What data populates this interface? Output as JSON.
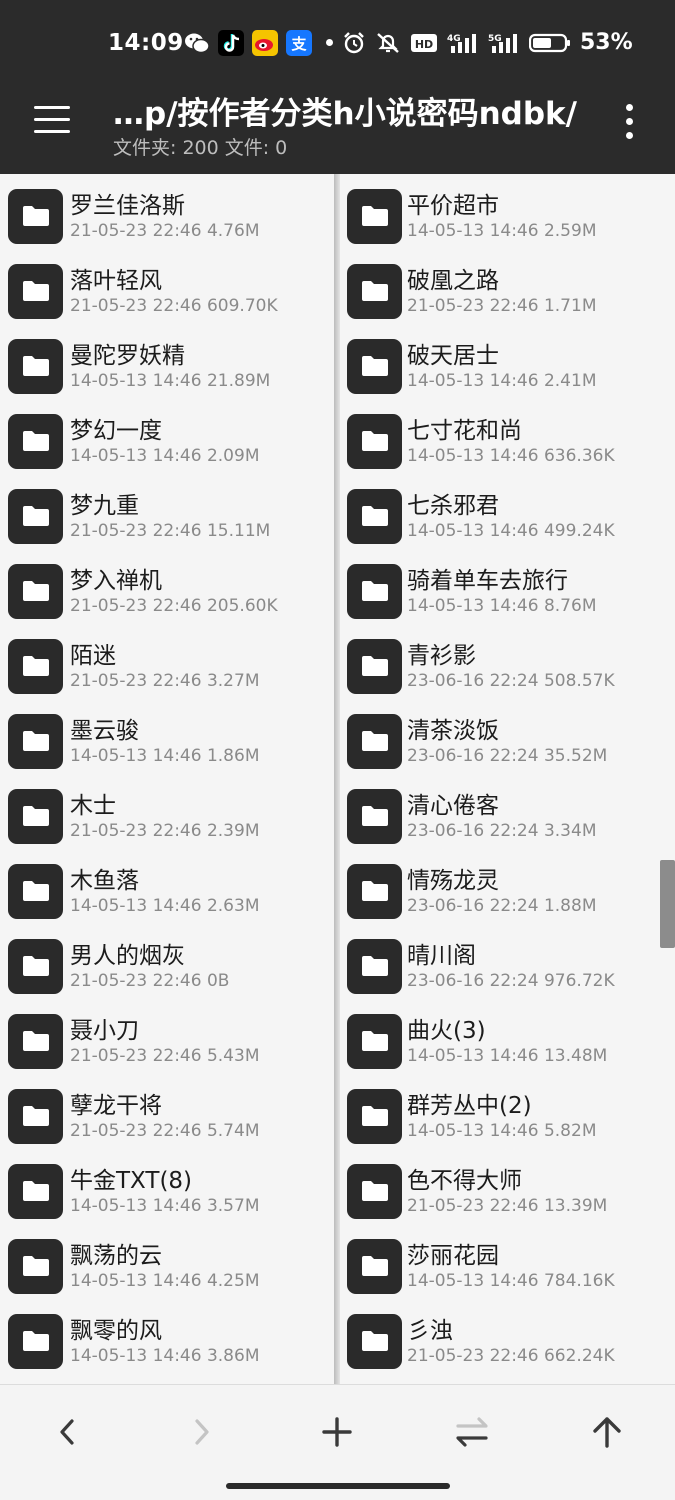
{
  "status_bar": {
    "time": "14:09",
    "apps": [
      {
        "icon": "wechat-icon",
        "glyph": "✿",
        "color": "#ffffff"
      },
      {
        "icon": "tiktok-icon",
        "glyph": "♪",
        "color": "#ffffff"
      },
      {
        "icon": "weibo-icon",
        "glyph": "◉",
        "color": "#e6162d"
      },
      {
        "icon": "alipay-icon",
        "glyph": "支",
        "color": "#1677ff"
      }
    ],
    "hd_label": "HD",
    "signal_4g": "4G",
    "signal_5g": "5G",
    "battery_text": "53%"
  },
  "header": {
    "title": "…p/按作者分类h小说密码ndbk/",
    "subtitle": "文件夹: 200  文件: 0"
  },
  "left_pane": {
    "items": [
      {
        "name": "罗兰佳洛斯",
        "meta": "21-05-23 22:46  4.76M"
      },
      {
        "name": "落叶轻风",
        "meta": "21-05-23 22:46  609.70K"
      },
      {
        "name": "曼陀罗妖精",
        "meta": "14-05-13 14:46  21.89M"
      },
      {
        "name": "梦幻一度",
        "meta": "14-05-13 14:46  2.09M"
      },
      {
        "name": "梦九重",
        "meta": "21-05-23 22:46  15.11M"
      },
      {
        "name": "梦入禅机",
        "meta": "21-05-23 22:46  205.60K"
      },
      {
        "name": "陌迷",
        "meta": "21-05-23 22:46  3.27M"
      },
      {
        "name": "墨云骏",
        "meta": "14-05-13 14:46  1.86M"
      },
      {
        "name": "木士",
        "meta": "21-05-23 22:46  2.39M"
      },
      {
        "name": "木鱼落",
        "meta": "14-05-13 14:46  2.63M"
      },
      {
        "name": "男人的烟灰",
        "meta": "21-05-23 22:46  0B"
      },
      {
        "name": "聂小刀",
        "meta": "21-05-23 22:46  5.43M"
      },
      {
        "name": "孽龙干将",
        "meta": "21-05-23 22:46  5.74M"
      },
      {
        "name": "牛金TXT(8)",
        "meta": "14-05-13 14:46  3.57M"
      },
      {
        "name": "飘荡的云",
        "meta": "14-05-13 14:46  4.25M"
      },
      {
        "name": "飘零的风",
        "meta": "14-05-13 14:46  3.86M"
      }
    ]
  },
  "right_pane": {
    "items": [
      {
        "name": "平价超市",
        "meta": "14-05-13 14:46  2.59M"
      },
      {
        "name": "破凰之路",
        "meta": "21-05-23 22:46  1.71M"
      },
      {
        "name": "破天居士",
        "meta": "14-05-13 14:46  2.41M"
      },
      {
        "name": "七寸花和尚",
        "meta": "14-05-13 14:46  636.36K"
      },
      {
        "name": "七杀邪君",
        "meta": "14-05-13 14:46  499.24K"
      },
      {
        "name": "骑着单车去旅行",
        "meta": "14-05-13 14:46  8.76M"
      },
      {
        "name": "青衫影",
        "meta": "23-06-16 22:24  508.57K"
      },
      {
        "name": "清茶淡饭",
        "meta": "23-06-16 22:24  35.52M"
      },
      {
        "name": "清心倦客",
        "meta": "23-06-16 22:24  3.34M"
      },
      {
        "name": "情殇龙灵",
        "meta": "23-06-16 22:24  1.88M"
      },
      {
        "name": "晴川阁",
        "meta": "23-06-16 22:24  976.72K"
      },
      {
        "name": "曲火(3)",
        "meta": "14-05-13 14:46  13.48M"
      },
      {
        "name": "群芳丛中(2)",
        "meta": "14-05-13 14:46  5.82M"
      },
      {
        "name": "色不得大师",
        "meta": "21-05-23 22:46  13.39M"
      },
      {
        "name": "莎丽花园",
        "meta": "14-05-13 14:46  784.16K"
      },
      {
        "name": "彡浊",
        "meta": "21-05-23 22:46  662.24K"
      }
    ]
  },
  "toolbar": {
    "buttons": [
      {
        "name": "back-button",
        "icon": "chevron-left-icon",
        "enabled": true
      },
      {
        "name": "forward-button",
        "icon": "chevron-right-icon",
        "enabled": false
      },
      {
        "name": "add-button",
        "icon": "plus-icon",
        "enabled": true
      },
      {
        "name": "swap-panes-button",
        "icon": "swap-arrows-icon",
        "enabled": true
      },
      {
        "name": "parent-folder-button",
        "icon": "arrow-up-icon",
        "enabled": true
      }
    ]
  },
  "colors": {
    "header_bg": "#2b2b2b",
    "pane_bg": "#f5f5f5",
    "folder_icon_bg": "#2a2a2a",
    "text_primary": "#1c1c1c",
    "text_secondary": "#8a8a8a",
    "icon_disabled": "#c4c4c4"
  }
}
